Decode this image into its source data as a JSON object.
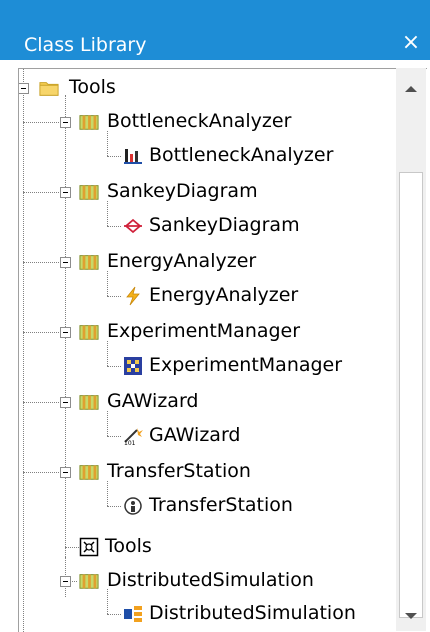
{
  "window": {
    "title": "Class Library",
    "close_glyph": "×"
  },
  "tree": {
    "root": {
      "label": "Tools",
      "icon": "folder-icon"
    },
    "items": [
      {
        "group": "BottleneckAnalyzer",
        "child": "BottleneckAnalyzer",
        "child_icon": "bottleneck-analyzer-icon"
      },
      {
        "group": "SankeyDiagram",
        "child": "SankeyDiagram",
        "child_icon": "sankey-diagram-icon"
      },
      {
        "group": "EnergyAnalyzer",
        "child": "EnergyAnalyzer",
        "child_icon": "energy-analyzer-icon"
      },
      {
        "group": "ExperimentManager",
        "child": "ExperimentManager",
        "child_icon": "experiment-manager-icon"
      },
      {
        "group": "GAWizard",
        "child": "GAWizard",
        "child_icon": "ga-wizard-icon"
      },
      {
        "group": "TransferStation",
        "child": "TransferStation",
        "child_icon": "transfer-station-icon"
      }
    ],
    "tools_leaf": {
      "label": "Tools",
      "icon": "tools-frame-icon"
    },
    "last_group": {
      "group": "DistributedSimulation",
      "child": "DistributedSimulation",
      "child_icon": "distributed-simulation-icon"
    }
  },
  "colors": {
    "titlebar": "#1e8dd6",
    "folder": "#f2c94c",
    "library": "#9bbb3a"
  }
}
